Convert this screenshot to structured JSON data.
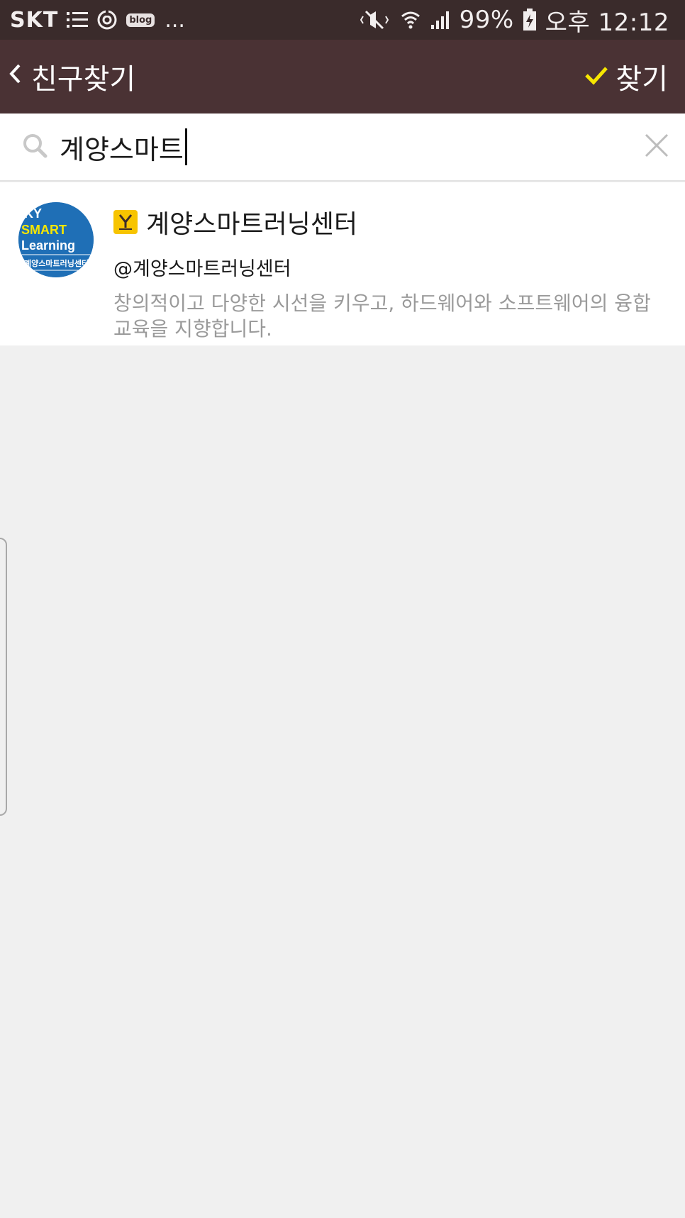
{
  "status_bar": {
    "carrier": "SKT",
    "more": "...",
    "blog": "blog",
    "battery": "99%",
    "time": "오후 12:12"
  },
  "header": {
    "back_label": "친구찾기",
    "find_label": "찾기"
  },
  "search": {
    "value": "계양스마트"
  },
  "result": {
    "name": "계양스마트러닝센터",
    "id": "@계양스마트러닝센터",
    "description": "창의적이고 다양한 시선을 키우고, 하드웨어와 소프트웨어의 융합교육을 지향합니다.",
    "avatar_lines": [
      "KY",
      "SMART",
      "Learning",
      "계양스마트러닝센터"
    ]
  },
  "colors": {
    "status_bar_bg": "#3a2b2b",
    "app_bar_bg": "#4a3234",
    "accent_check": "#f7e600",
    "badge_yellow": "#f7c400",
    "avatar_blue": "#1f6fb6"
  },
  "icons": [
    "menu-list-icon",
    "sync-icon",
    "blog-icon",
    "mute-icon",
    "wifi-icon",
    "signal-icon",
    "battery-charging-icon",
    "back-chevron-icon",
    "check-icon",
    "search-icon",
    "close-icon",
    "y-plus-friend-icon"
  ]
}
